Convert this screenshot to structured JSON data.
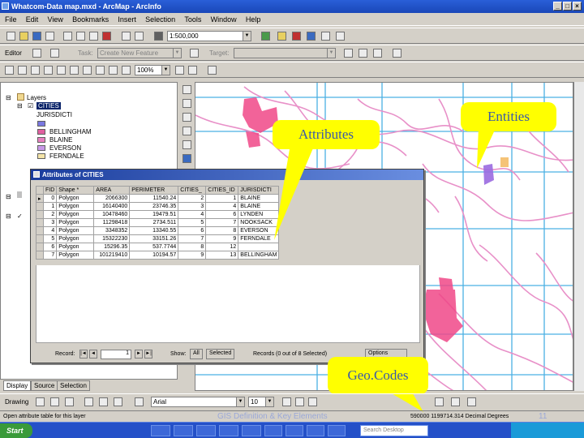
{
  "window": {
    "title": "Whatcom-Data map.mxd - ArcMap - ArcInfo"
  },
  "menu": [
    "File",
    "Edit",
    "View",
    "Bookmarks",
    "Insert",
    "Selection",
    "Tools",
    "Window",
    "Help"
  ],
  "toolbar": {
    "scale_value": "1:500,000",
    "editor_label": "Editor",
    "task_label": "Task:",
    "task_value": "Create New Feature",
    "target_label": "Target:",
    "zoom_value": "100%"
  },
  "toc": {
    "layers_label": "Layers",
    "cities_label": "CITIES",
    "field_label": "JURISDICTI",
    "legend_items": [
      {
        "label": "",
        "color": "#7a78e0"
      },
      {
        "label": "BELLINGHAM",
        "color": "#e060a0"
      },
      {
        "label": "BLAINE",
        "color": "#e880c0"
      },
      {
        "label": "EVERSON",
        "color": "#c898e8"
      },
      {
        "label": "FERNDALE",
        "color": "#f4e4a8"
      }
    ],
    "tabs": [
      "Display",
      "Source",
      "Selection"
    ]
  },
  "dialog": {
    "title": "Attributes of CITIES",
    "columns": [
      "FID",
      "Shape *",
      "AREA",
      "PERIMETER",
      "CITIES_",
      "CITIES_ID",
      "JURISDICTI"
    ],
    "rows": [
      [
        "0",
        "Polygon",
        "2066300",
        "11540.24",
        "2",
        "1",
        "BLAINE"
      ],
      [
        "1",
        "Polygon",
        "16140400",
        "23746.35",
        "3",
        "4",
        "BLAINE"
      ],
      [
        "2",
        "Polygon",
        "10478460",
        "19479.51",
        "4",
        "6",
        "LYNDEN"
      ],
      [
        "3",
        "Polygon",
        "11298418",
        "2734.511",
        "5",
        "7",
        "NOOKSACK"
      ],
      [
        "4",
        "Polygon",
        "3348352",
        "13340.55",
        "6",
        "8",
        "EVERSON"
      ],
      [
        "5",
        "Polygon",
        "15322230",
        "33151.26",
        "7",
        "9",
        "FERNDALE"
      ],
      [
        "6",
        "Polygon",
        "15296.35",
        "537.7744",
        "8",
        "12",
        ""
      ],
      [
        "7",
        "Polygon",
        "101219410",
        "10194.57",
        "9",
        "13",
        "BELLINGHAM"
      ]
    ],
    "record_label": "Record:",
    "record_value": "1",
    "show_label": "Show:",
    "all_button": "All",
    "selected_button": "Selected",
    "records_status": "Records (0 out of 8 Selected)",
    "options_button": "Options"
  },
  "callouts": {
    "attributes": "Attributes",
    "entities": "Entities",
    "geocodes": "Geo.Codes"
  },
  "drawing_toolbar": {
    "label": "Drawing",
    "font_value": "Arial",
    "size_value": "10"
  },
  "status": {
    "left": "Open attribute table for this layer",
    "coords": "590000 1199714.314 Decimal Degrees"
  },
  "footer": {
    "slide_title": "GIS Definition & Key Elements",
    "page": "11"
  },
  "taskbar": {
    "start_label": "Start",
    "search_placeholder": "Search Desktop"
  },
  "colors": {
    "water": "#e890c8",
    "cities": "#f04888",
    "grid": "#38a8e0",
    "callout": "#ffff00"
  }
}
